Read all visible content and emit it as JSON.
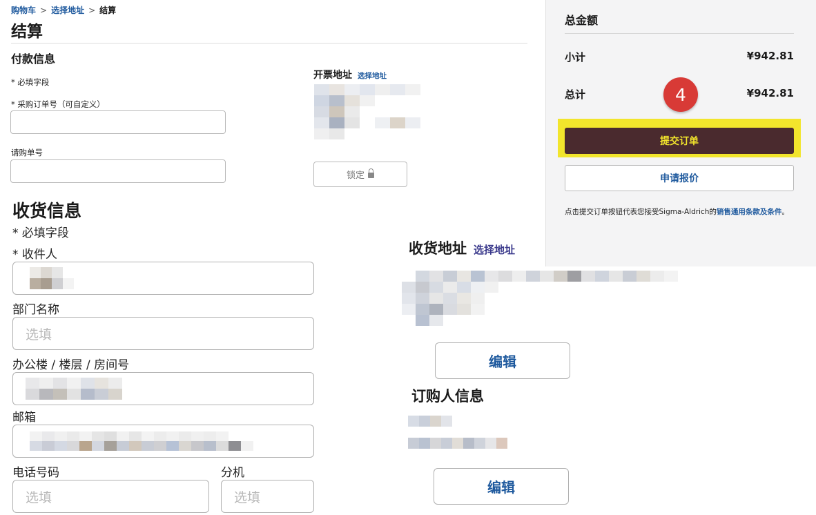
{
  "breadcrumb": {
    "cart": "购物车",
    "select_address": "选择地址",
    "current": "结算",
    "separator": ">"
  },
  "page_title": "结算",
  "payment": {
    "heading": "付款信息",
    "required_note": "* 必填字段",
    "po_label": "* 采购订单号（可自定义）",
    "requisition_label": "请购单号",
    "billing_address_title": "开票地址",
    "billing_select_link": "选择地址",
    "locked_button": "锁定"
  },
  "shipping": {
    "heading": "收货信息",
    "required_note": "* 必填字段",
    "recipient_label": "* 收件人",
    "department_label": "部门名称",
    "department_placeholder": "选填",
    "building_label": "办公楼 / 楼层 / 房间号",
    "email_label": "邮箱",
    "phone_label": "电话号码",
    "phone_placeholder": "选填",
    "extension_label": "分机",
    "extension_placeholder": "选填",
    "address_title": "收货地址",
    "address_select_link": "选择地址",
    "edit_label": "编辑"
  },
  "orderer": {
    "heading": "订购人信息",
    "edit_label": "编辑"
  },
  "summary": {
    "title": "总金额",
    "subtotal_label": "小计",
    "subtotal_value": "¥942.81",
    "total_label": "总计",
    "total_value": "¥942.81",
    "step_number": "4",
    "submit_button": "提交订单",
    "quote_button": "申请报价",
    "terms_prefix": "点击提交订单按钮代表您接受Sigma-Aldrich的",
    "terms_link": "销售通用条款及条件",
    "terms_suffix": "。"
  },
  "colors": {
    "link_blue": "#1f5a9e",
    "submit_bg": "#4a2a2e",
    "highlight_yellow": "#f2e52c",
    "badge_red": "#d83a36"
  }
}
